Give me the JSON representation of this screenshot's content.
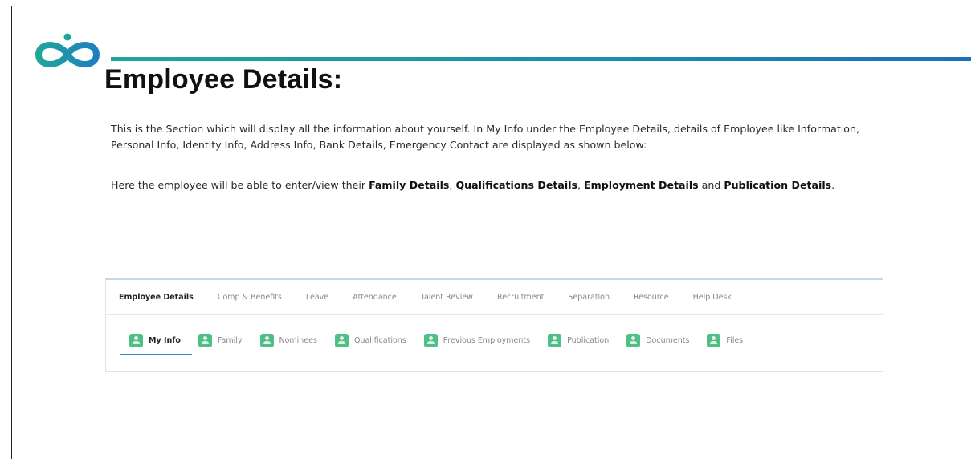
{
  "document": {
    "title": "Employee Details:",
    "paragraph1": "This is the Section which will display all the information about yourself. In My Info under the Employee Details, details of Employee like Information, Personal Info, Identity Info, Address Info, Bank Details, Emergency Contact are displayed as shown below:",
    "paragraph2": {
      "prefix": "Here the employee will be able to enter/view their ",
      "family": "Family Details",
      "sep1": ", ",
      "qualifications": "Qualifications Details",
      "sep2": ", ",
      "employment": "Employment Details",
      "sep3": " and ",
      "publication": "Publication Details",
      "suffix": "."
    }
  },
  "screenshot": {
    "top_tabs": [
      {
        "label": "Employee Details",
        "active": true
      },
      {
        "label": "Comp & Benefits",
        "active": false
      },
      {
        "label": "Leave",
        "active": false
      },
      {
        "label": "Attendance",
        "active": false
      },
      {
        "label": "Talent Review",
        "active": false
      },
      {
        "label": "Recruitment",
        "active": false
      },
      {
        "label": "Separation",
        "active": false
      },
      {
        "label": "Resource",
        "active": false
      },
      {
        "label": "Help Desk",
        "active": false
      }
    ],
    "sub_tabs": [
      {
        "label": "My Info",
        "active": true,
        "icon": "person-icon"
      },
      {
        "label": "Family",
        "active": false,
        "icon": "person-icon"
      },
      {
        "label": "Nominees",
        "active": false,
        "icon": "person-icon"
      },
      {
        "label": "Qualifications",
        "active": false,
        "icon": "person-icon"
      },
      {
        "label": "Previous Employments",
        "active": false,
        "icon": "person-icon"
      },
      {
        "label": "Publication",
        "active": false,
        "icon": "person-icon"
      },
      {
        "label": "Documents",
        "active": false,
        "icon": "person-icon"
      },
      {
        "label": "Files",
        "active": false,
        "icon": "person-icon"
      }
    ]
  },
  "colors": {
    "accent_teal": "#1fa69a",
    "accent_blue": "#1e6fb8",
    "tab_icon_green": "#4fbf86",
    "active_underline": "#2d8ad1"
  }
}
